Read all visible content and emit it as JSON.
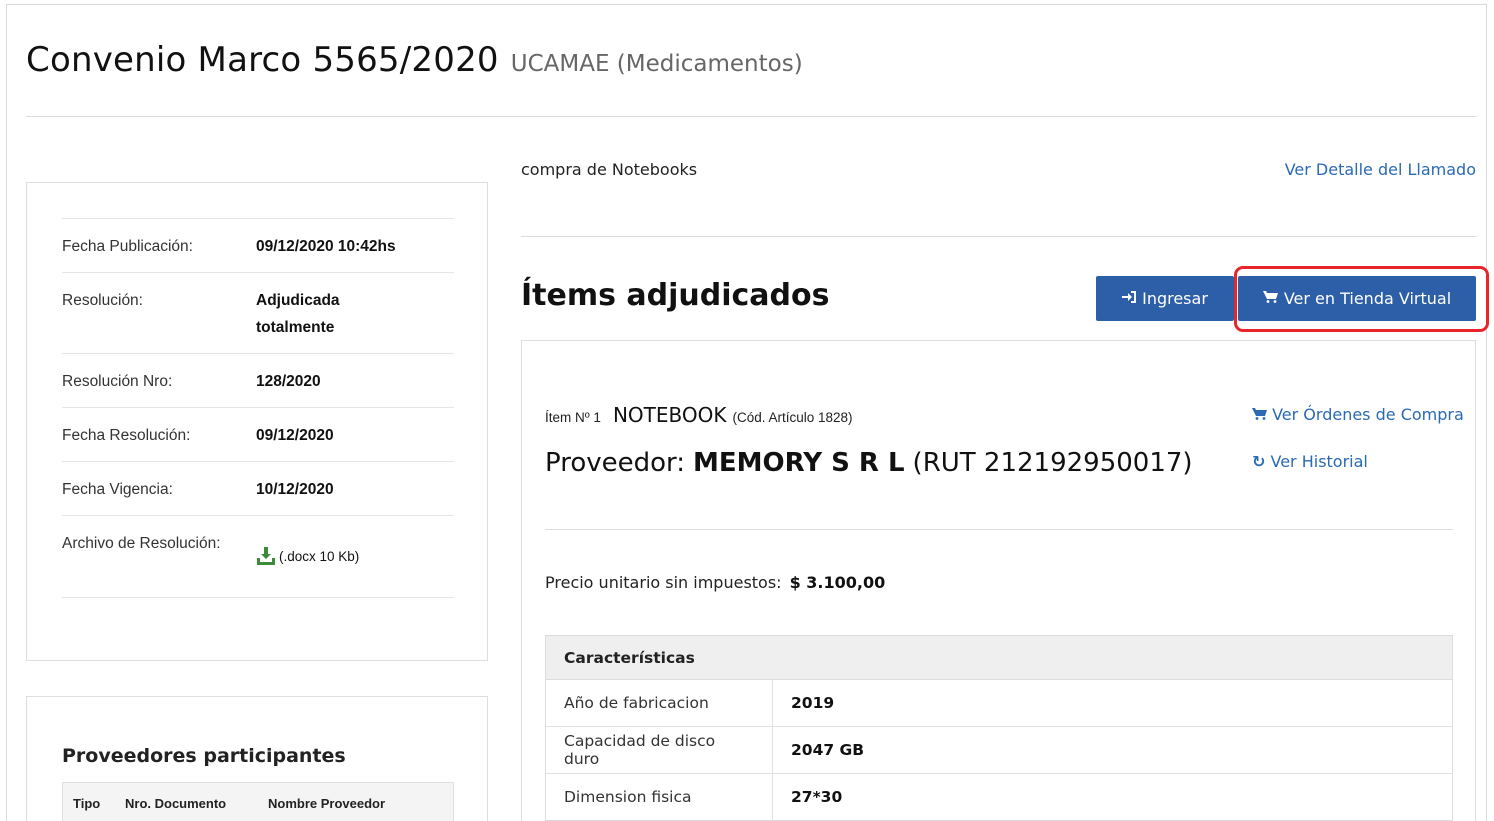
{
  "header": {
    "title": "Convenio Marco 5565/2020",
    "subtitle": "UCAMAE (Medicamentos)"
  },
  "info": {
    "rows": [
      {
        "label": "Fecha Publicación:",
        "value": "09/12/2020 10:42hs"
      },
      {
        "label": "Resolución:",
        "value": "Adjudicada totalmente"
      },
      {
        "label": "Resolución Nro:",
        "value": "128/2020"
      },
      {
        "label": "Fecha Resolución:",
        "value": "09/12/2020"
      },
      {
        "label": "Fecha Vigencia:",
        "value": "10/12/2020"
      },
      {
        "label": "Archivo de Resolución:",
        "value": "(.docx 10 Kb)"
      }
    ]
  },
  "providers": {
    "title": "Proveedores participantes",
    "columns": [
      "Tipo",
      "Nro. Documento",
      "Nombre Proveedor"
    ]
  },
  "main": {
    "description": "compra de Notebooks",
    "detail_link": "Ver Detalle del Llamado",
    "items_title": "Ítems adjudicados",
    "login_button": "Ingresar",
    "store_button": "Ver en Tienda Virtual"
  },
  "item": {
    "number": "Ítem Nº 1",
    "name": "NOTEBOOK",
    "code": "(Cód. Artículo 1828)",
    "supplier_prefix": "Proveedor:",
    "supplier_name": "MEMORY S R L",
    "supplier_rut": "(RUT 212192950017)",
    "orders_link": "Ver Órdenes de Compra",
    "history_link": "Ver Historial",
    "price_label": "Precio unitario sin impuestos:",
    "price_value": "$ 3.100,00",
    "characteristics_header": "Características",
    "characteristics": [
      {
        "key": "Año de fabricacion",
        "value": "2019"
      },
      {
        "key": "Capacidad de disco duro",
        "value": "2047 GB"
      },
      {
        "key": "Dimension fisica",
        "value": "27*30"
      }
    ]
  },
  "colors": {
    "accent": "#2d5fa8",
    "link": "#2a6ab3",
    "highlight": "#e8252b",
    "download_icon": "#3c8a3a"
  }
}
